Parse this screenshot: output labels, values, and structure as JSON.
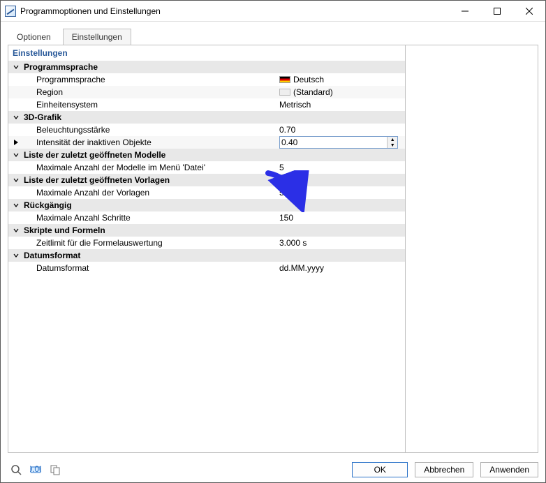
{
  "window": {
    "title": "Programmoptionen und Einstellungen"
  },
  "tabs": {
    "options": "Optionen",
    "settings": "Einstellungen"
  },
  "settings": {
    "title": "Einstellungen",
    "groups": {
      "lang": {
        "title": "Programmsprache",
        "rows": {
          "lang": {
            "label": "Programmsprache",
            "value": "Deutsch"
          },
          "region": {
            "label": "Region",
            "value": "(Standard)"
          },
          "units": {
            "label": "Einheitensystem",
            "value": "Metrisch"
          }
        }
      },
      "gfx": {
        "title": "3D-Grafik",
        "rows": {
          "lighting": {
            "label": "Beleuchtungsstärke",
            "value": "0.70"
          },
          "intensity": {
            "label": "Intensität der inaktiven Objekte",
            "value": "0.40"
          }
        }
      },
      "recent_models": {
        "title": "Liste der zuletzt geöffneten Modelle",
        "rows": {
          "max": {
            "label": "Maximale Anzahl der Modelle im Menü 'Datei'",
            "value": "5"
          }
        }
      },
      "recent_templates": {
        "title": "Liste der zuletzt geöffneten Vorlagen",
        "rows": {
          "max": {
            "label": "Maximale Anzahl der Vorlagen",
            "value": "5"
          }
        }
      },
      "undo": {
        "title": "Rückgängig",
        "rows": {
          "max": {
            "label": "Maximale Anzahl Schritte",
            "value": "150"
          }
        }
      },
      "scripts": {
        "title": "Skripte und Formeln",
        "rows": {
          "timeout": {
            "label": "Zeitlimit für die Formelauswertung",
            "value": "3.000 s"
          }
        }
      },
      "date": {
        "title": "Datumsformat",
        "rows": {
          "fmt": {
            "label": "Datumsformat",
            "value": "dd.MM.yyyy"
          }
        }
      }
    }
  },
  "footer": {
    "ok": "OK",
    "cancel": "Abbrechen",
    "apply": "Anwenden"
  }
}
